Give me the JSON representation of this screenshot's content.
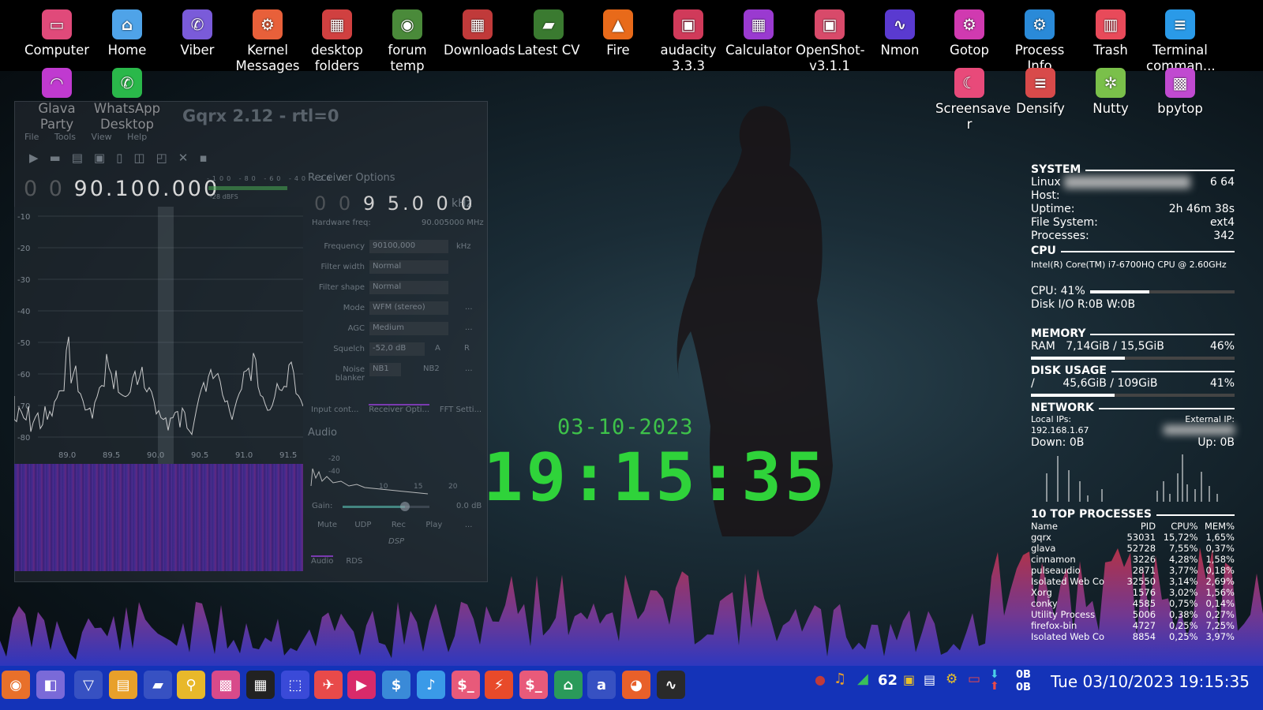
{
  "desktop_icons_row1": [
    {
      "label": "Computer",
      "icon": "computer-icon",
      "color": "#e04a7a"
    },
    {
      "label": "Home",
      "icon": "home-icon",
      "color": "#4fa3e8"
    },
    {
      "label": "Viber",
      "icon": "viber-icon",
      "color": "#7a5bd9"
    },
    {
      "label": "Kernel\nMessages",
      "icon": "gear-icon",
      "color": "#e8603a"
    },
    {
      "label": "desktop\nfolders",
      "icon": "archive-icon",
      "color": "#d04040"
    },
    {
      "label": "forum\ntemp",
      "icon": "folder-camera-icon",
      "color": "#4a8a3a"
    },
    {
      "label": "Downloads",
      "icon": "archive-icon",
      "color": "#c03a3a"
    },
    {
      "label": "Latest CV",
      "icon": "folder-icon",
      "color": "#3a7a30"
    },
    {
      "label": "Fire",
      "icon": "fire-icon",
      "color": "#e86a1a"
    },
    {
      "label": "audacity\n3.3.3",
      "icon": "app-icon",
      "color": "#d03a5a"
    },
    {
      "label": "Calculator",
      "icon": "calculator-icon",
      "color": "#9a3ad0"
    },
    {
      "label": "OpenShot-\nv3.1.1",
      "icon": "app-icon",
      "color": "#d84a6a"
    },
    {
      "label": "Nmon",
      "icon": "chart-icon",
      "color": "#5a3ad0"
    },
    {
      "label": "Gotop",
      "icon": "gear-icon",
      "color": "#d03ab0"
    },
    {
      "label": "Process\nInfo",
      "icon": "gear-icon",
      "color": "#2a8ad8"
    },
    {
      "label": "Trash",
      "icon": "trash-icon",
      "color": "#e84a5a"
    },
    {
      "label": "Terminal\ncomman...",
      "icon": "document-icon",
      "color": "#2a9ae8"
    }
  ],
  "desktop_icons_row2_left": [
    {
      "label": "Glava Party",
      "icon": "headphones-icon",
      "color": "#c03ad0"
    },
    {
      "label": "WhatsApp\nDesktop",
      "icon": "whatsapp-icon",
      "color": "#2ab84a"
    }
  ],
  "desktop_icons_row2_right": [
    {
      "label": "Screensave\nr",
      "icon": "moon-icon",
      "color": "#e84a7a"
    },
    {
      "label": "Densify",
      "icon": "document-icon",
      "color": "#d84a4a"
    },
    {
      "label": "Nutty",
      "icon": "network-icon",
      "color": "#7ac04a"
    },
    {
      "label": "bpytop",
      "icon": "chip-icon",
      "color": "#c04ad0"
    }
  ],
  "gqrx": {
    "title": "Gqrx 2.12 - rtl=0",
    "menu": [
      "File",
      "Tools",
      "View",
      "Help"
    ],
    "frequency_dim": "0 0",
    "frequency": "90.100.000",
    "db_scale": [
      "-100",
      "-80",
      "-60",
      "-40",
      "-20",
      "0"
    ],
    "dbfs": "-28 dBFS",
    "y_ticks": [
      "-10",
      "-20",
      "-30",
      "-40",
      "-50",
      "-60",
      "-70",
      "-80"
    ],
    "x_ticks": [
      "89.0",
      "89.5",
      "90.0",
      "90.5",
      "91.0",
      "91.5"
    ],
    "receiver_title": "Receiver Options",
    "offset_dim": "0 0",
    "offset": "9 5.0 0 0",
    "offset_unit": "kHz",
    "hw_freq_label": "Hardware freq:",
    "hw_freq_value": "90.005000 MHz",
    "fields": [
      {
        "label": "Frequency",
        "value": "90100,000",
        "unit": "kHz"
      },
      {
        "label": "Filter width",
        "value": "Normal"
      },
      {
        "label": "Filter shape",
        "value": "Normal"
      },
      {
        "label": "Mode",
        "value": "WFM (stereo)"
      },
      {
        "label": "AGC",
        "value": "Medium"
      },
      {
        "label": "Squelch",
        "value": "-52,0 dB"
      },
      {
        "label": "Noise blanker",
        "value": "NB1"
      }
    ],
    "nb2": "NB2",
    "squelch_btn_a": "A",
    "squelch_btn_r": "R",
    "more_btn": "...",
    "tabs": [
      "Input cont...",
      "Receiver Opti...",
      "FFT Setti..."
    ],
    "audio_title": "Audio",
    "audio_ticks": [
      "-20",
      "-40",
      "10",
      "15",
      "20"
    ],
    "gain_label": "Gain:",
    "gain_value": "0.0 dB",
    "gain_level": 0.72,
    "audio_buttons": [
      "Mute",
      "UDP",
      "Rec",
      "Play",
      "..."
    ],
    "dsp": "DSP",
    "bottom_tabs": [
      "Audio",
      "RDS"
    ]
  },
  "clock": {
    "date": "03-10-2023",
    "time": "19:15:35"
  },
  "conky": {
    "system": {
      "title": "SYSTEM",
      "linux_label": "Linux",
      "linux_tail": "6  64",
      "host_label": "Host:",
      "uptime_label": "Uptime:",
      "uptime": "2h 46m 38s",
      "fs_label": "File System:",
      "fs": "ext4",
      "proc_label": "Processes:",
      "proc": "342"
    },
    "cpu": {
      "title": "CPU",
      "model": "Intel(R) Core(TM) i7-6700HQ CPU @ 2.60GHz",
      "usage_label": "CPU: 41%",
      "usage": 0.41,
      "disk_io": "Disk I/O R:0B   W:0B"
    },
    "memory": {
      "title": "MEMORY",
      "ram_label": "RAM",
      "ram": "7,14GiB / 15,5GiB",
      "ram_pct": "46%",
      "ram_frac": 0.46
    },
    "disk": {
      "title": "DISK USAGE",
      "mount": "/",
      "used": "45,6GiB / 109GiB",
      "pct": "41%",
      "frac": 0.41
    },
    "network": {
      "title": "NETWORK",
      "local_label": "Local IPs:",
      "external_label": "External IP:",
      "local_ip": "192.168.1.67",
      "down": "Down: 0B",
      "up": "Up: 0B"
    },
    "processes": {
      "title": "10 TOP PROCESSES",
      "headers": [
        "Name",
        "PID",
        "CPU%",
        "MEM%"
      ],
      "rows": [
        [
          "gqrx",
          "53031",
          "15,72%",
          "1,65%"
        ],
        [
          "glava",
          "52728",
          "7,55%",
          "0,37%"
        ],
        [
          "cinnamon",
          "3226",
          "4,28%",
          "1,58%"
        ],
        [
          "pulseaudio",
          "2871",
          "3,77%",
          "0,18%"
        ],
        [
          "Isolated Web Co",
          "32550",
          "3,14%",
          "2,69%"
        ],
        [
          "Xorg",
          "1576",
          "3,02%",
          "1,56%"
        ],
        [
          "conky",
          "4585",
          "0,75%",
          "0,14%"
        ],
        [
          "Utility Process",
          "5006",
          "0,38%",
          "0,27%"
        ],
        [
          "firefox-bin",
          "4727",
          "0,25%",
          "7,25%"
        ],
        [
          "Isolated Web Co",
          "8854",
          "0,25%",
          "3,97%"
        ]
      ]
    }
  },
  "taskbar": {
    "apps": [
      {
        "icon": "menu-icon",
        "color": "#e8702a"
      },
      {
        "icon": "workspace-icon",
        "color": "#7a6ad8"
      },
      {
        "icon": "browser-icon",
        "color": "#ffffff"
      },
      {
        "icon": "files-icon",
        "color": "#e8a02a"
      },
      {
        "icon": "disk-icon",
        "color": "#d8d8d8"
      },
      {
        "icon": "search-icon",
        "color": "#e8b82a"
      },
      {
        "icon": "chip-icon",
        "color": "#d84a8a"
      },
      {
        "icon": "keyboard-icon",
        "color": "#222222"
      },
      {
        "icon": "screenshot-icon",
        "color": "#3a4ad8"
      },
      {
        "icon": "plane-icon",
        "color": "#e84a4a"
      },
      {
        "icon": "video-icon",
        "color": "#d82a6a"
      },
      {
        "icon": "money-icon",
        "color": "#3a8ad8"
      },
      {
        "icon": "music-icon",
        "color": "#3a9ae8"
      },
      {
        "icon": "terminal-icon",
        "color": "#e85a7a"
      },
      {
        "icon": "bolt-icon",
        "color": "#e84a2a"
      },
      {
        "icon": "terminal-icon",
        "color": "#e85a7a"
      },
      {
        "icon": "home-clock-icon",
        "color": "#2a9a5a"
      },
      {
        "icon": "amazon-icon",
        "color": "#ffffff"
      },
      {
        "icon": "firefox-icon",
        "color": "#e8602a"
      },
      {
        "icon": "monitor-icon",
        "color": "#2a2a2a"
      }
    ],
    "tray_temp": "62",
    "net_down": "0B",
    "net_up": "0B",
    "datetime": "Tue 03/10/2023 19:15:35"
  }
}
